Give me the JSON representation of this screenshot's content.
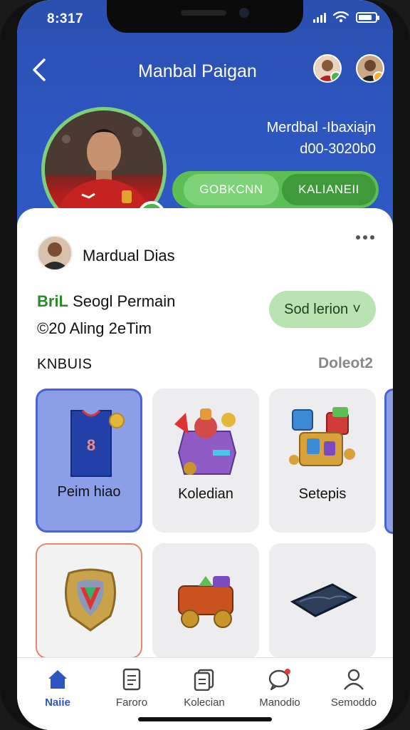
{
  "status": {
    "time": "8:317"
  },
  "header": {
    "title": "Manbal Paigan"
  },
  "hero": {
    "name": "Merdbal -Ibaxiajn",
    "id": "d00-3020b0",
    "primary_button": "GOBKCNN",
    "secondary_button": "KALIANEII"
  },
  "profile": {
    "user_name": "Mardual Dias",
    "level_prefix": "BriL",
    "level_text": " Seogl Permain",
    "stats": "©20 Aling 2eTim",
    "filter_label": "Sod lerion",
    "filter_chevron": "˅"
  },
  "section": {
    "label": "KNBUIS",
    "link": "Doleot2"
  },
  "tiles": [
    {
      "label": "Peim hiao",
      "jersey_number": "8",
      "icon": "jersey-icon"
    },
    {
      "label": "Koledian",
      "icon": "treasure-chest-icon"
    },
    {
      "label": "Setepis",
      "icon": "golden-cubes-icon"
    },
    {
      "label": "",
      "icon": "shield-emblem-icon"
    },
    {
      "label": "",
      "icon": "cart-icon"
    },
    {
      "label": "",
      "icon": "wallet-icon"
    }
  ],
  "tabs": [
    {
      "label": "Naiie",
      "icon": "home-icon",
      "active": true
    },
    {
      "label": "Faroro",
      "icon": "document-icon"
    },
    {
      "label": "Kolecian",
      "icon": "collection-icon"
    },
    {
      "label": "Manodio",
      "icon": "chat-icon"
    },
    {
      "label": "Semoddo",
      "icon": "profile-icon"
    }
  ],
  "colors": {
    "header": "#2d56c0",
    "accent_green": "#5cbf55",
    "active_tab": "#2d56c0"
  }
}
